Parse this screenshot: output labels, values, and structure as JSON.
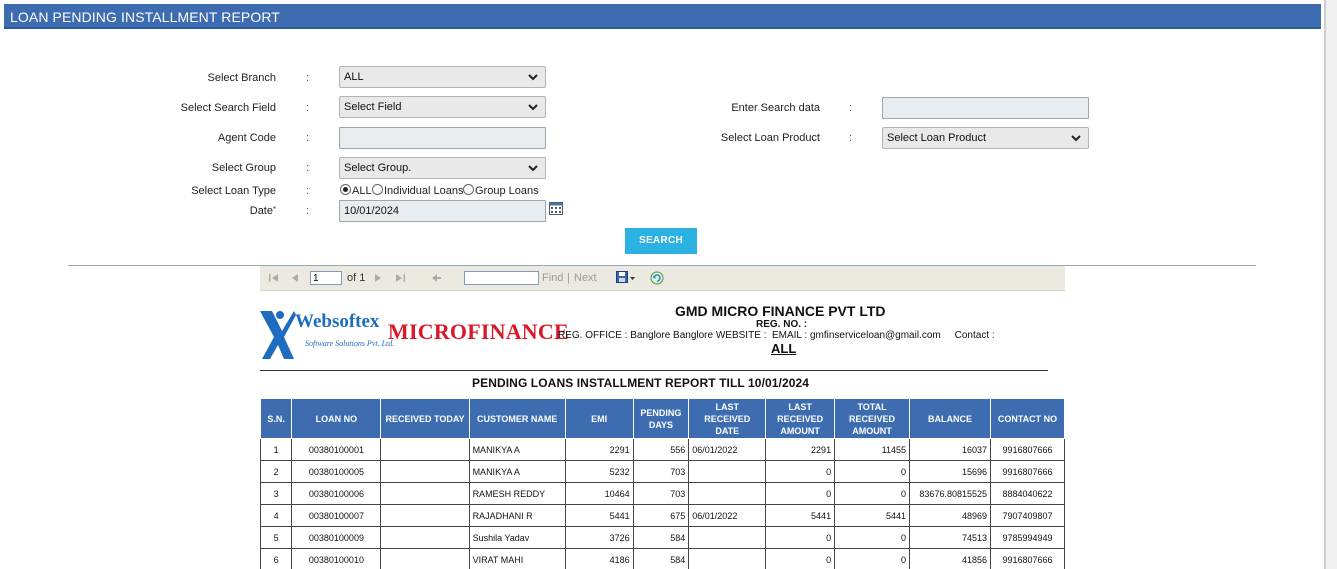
{
  "header": {
    "title": "LOAN PENDING INSTALLMENT REPORT"
  },
  "form": {
    "branch": {
      "label": "Select Branch",
      "value": "ALL"
    },
    "search_field": {
      "label": "Select Search Field",
      "value": "Select Field"
    },
    "search_data": {
      "label": "Enter Search data",
      "value": ""
    },
    "agent_code": {
      "label": "Agent Code",
      "value": ""
    },
    "loan_product": {
      "label": "Select Loan Product",
      "value": "Select Loan Product"
    },
    "group": {
      "label": "Select Group",
      "value": "Select Group."
    },
    "loan_type": {
      "label": "Select Loan Type",
      "options": [
        "ALL",
        "Individual Loans",
        "Group Loans"
      ],
      "selected": "ALL"
    },
    "date": {
      "label": "Date",
      "required_mark": "*",
      "value": "10/01/2024"
    },
    "colon": ":",
    "search_button": "SEARCH"
  },
  "toolbar": {
    "page": "1",
    "of_label": "of 1",
    "find_label": "Find",
    "separator": "|",
    "next_label": "Next"
  },
  "report": {
    "logo_text": "Websoftex",
    "logo_sub": "Software Solutions Pvt. Ltd.",
    "brand": "MICROFINANCE",
    "company": "GMD MICRO FINANCE PVT LTD",
    "reg_no": "REG. NO. :",
    "office_label": "REG. OFFICE :",
    "office_value": "Banglore Banglore",
    "website_label": "WEBSITE :",
    "email_label": "EMAIL :",
    "email_value": "gmfinserviceloan@gmail.com",
    "contact_label": "Contact :",
    "branch": "ALL",
    "title": "PENDING LOANS INSTALLMENT REPORT TILL 10/01/2024",
    "columns": [
      "S.N.",
      "LOAN NO",
      "RECEIVED TODAY",
      "CUSTOMER NAME",
      "EMI",
      "PENDING DAYS",
      "LAST RECEIVED DATE",
      "LAST RECEIVED AMOUNT",
      "TOTAL RECEIVED AMOUNT",
      "BALANCE",
      "CONTACT NO"
    ],
    "rows": [
      [
        "1",
        "00380100001",
        "",
        "MANIKYA A",
        "2291",
        "556",
        "06/01/2022",
        "2291",
        "11455",
        "16037",
        "9916807666"
      ],
      [
        "2",
        "00380100005",
        "",
        "MANIKYA A",
        "5232",
        "703",
        "",
        "0",
        "0",
        "15696",
        "9916807666"
      ],
      [
        "3",
        "00380100006",
        "",
        "RAMESH REDDY",
        "10464",
        "703",
        "",
        "0",
        "0",
        "83676.80815525",
        "8884040622"
      ],
      [
        "4",
        "00380100007",
        "",
        "RAJADHANI R",
        "5441",
        "675",
        "06/01/2022",
        "5441",
        "5441",
        "48969",
        "7907409807"
      ],
      [
        "5",
        "00380100009",
        "",
        "Sushila Yadav",
        "3726",
        "584",
        "",
        "0",
        "0",
        "74513",
        "9785994949"
      ],
      [
        "6",
        "00380100010",
        "",
        "VIRAT MAHI",
        "4186",
        "584",
        "",
        "0",
        "0",
        "41856",
        "9916807666"
      ],
      [
        "",
        "",
        "",
        "",
        "",
        "",
        "",
        "",
        "",
        "",
        ""
      ]
    ]
  }
}
